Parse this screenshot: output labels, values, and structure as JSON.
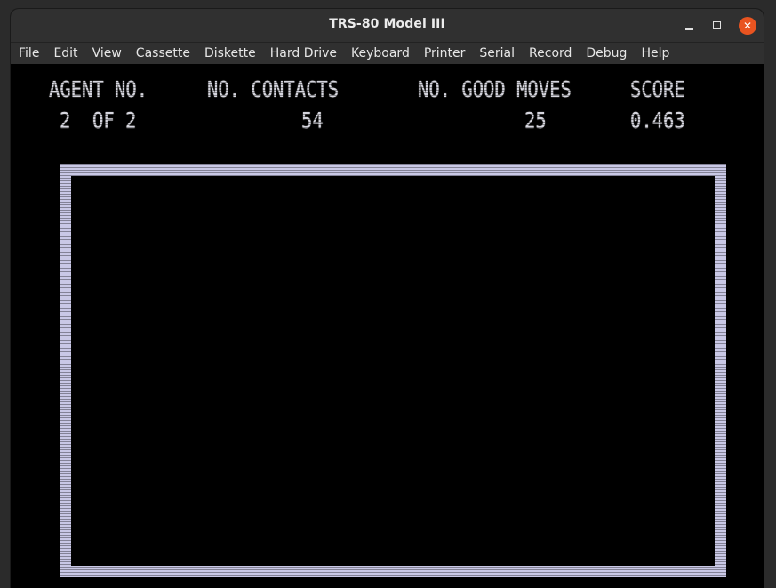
{
  "window": {
    "title": "TRS-80 Model III",
    "controls": {
      "minimize_icon": "minimize-icon",
      "maximize_icon": "maximize-icon",
      "close_icon": "close-icon",
      "close_color": "#e95420"
    }
  },
  "menubar": {
    "items": [
      "File",
      "Edit",
      "View",
      "Cassette",
      "Diskette",
      "Hard Drive",
      "Keyboard",
      "Printer",
      "Serial",
      "Record",
      "Debug",
      "Help"
    ]
  },
  "screen": {
    "headers": {
      "agent": "AGENT NO.",
      "contacts": "NO. CONTACTS",
      "good_moves": "NO. GOOD MOVES",
      "score": "SCORE"
    },
    "values": {
      "agent": "2  OF 2",
      "contacts": "54",
      "good_moves": "25",
      "score": "0.463"
    },
    "colors": {
      "text": "#d6d6df",
      "field_border": "#c9c8e6",
      "background": "#000000"
    }
  }
}
